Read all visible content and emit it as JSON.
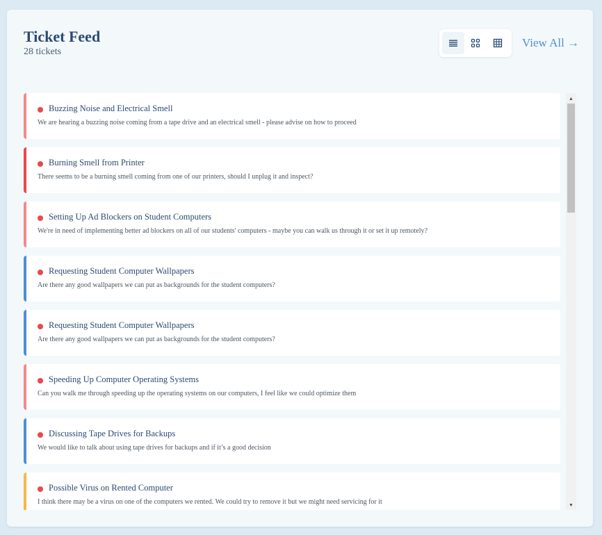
{
  "header": {
    "title": "Ticket Feed",
    "subtitle": "28 tickets",
    "view_all": "View All →"
  },
  "view_modes": [
    "list-icon",
    "grid-icon",
    "table-icon"
  ],
  "colors": {
    "accent": "#4f8fd6",
    "title": "#2a4a72",
    "dot": "#e84a4a",
    "border_red_light": "#f08a8a",
    "border_red": "#e84a4a",
    "border_blue": "#4a90d9",
    "border_orange": "#f5b94a"
  },
  "tickets": [
    {
      "title": "Buzzing Noise and Electrical Smell",
      "description": "We are hearing a buzzing noise coming from a tape drive and an electrical smell - please advise on how to proceed",
      "border": "#f08a8a"
    },
    {
      "title": "Burning Smell from Printer",
      "description": "There seems to be a burning smell coming from one of our printers, should I unplug it and inspect?",
      "border": "#e84a4a"
    },
    {
      "title": "Setting Up Ad Blockers on Student Computers",
      "description": "We're in need of implementing better ad blockers on all of our students' computers - maybe you can walk us through it or set it up remotely?",
      "border": "#f08a8a"
    },
    {
      "title": "Requesting Student Computer Wallpapers",
      "description": "Are there any good wallpapers we can put as backgrounds for the student computers?",
      "border": "#4a90d9"
    },
    {
      "title": "Requesting Student Computer Wallpapers",
      "description": "Are there any good wallpapers we can put as backgrounds for the student computers?",
      "border": "#4a90d9"
    },
    {
      "title": "Speeding Up Computer Operating Systems",
      "description": "Can you walk me through speeding up the operating systems on our computers, I feel like we could optimize them",
      "border": "#f08a8a"
    },
    {
      "title": "Discussing Tape Drives for Backups",
      "description": "We would like to talk about using tape drives for backups and if it’s a good decision",
      "border": "#4a90d9"
    },
    {
      "title": "Possible Virus on Rented Computer",
      "description": "I think there may be a virus on one of the computers we rented. We could try to remove it but we might need servicing for it",
      "border": "#f5b94a"
    }
  ]
}
